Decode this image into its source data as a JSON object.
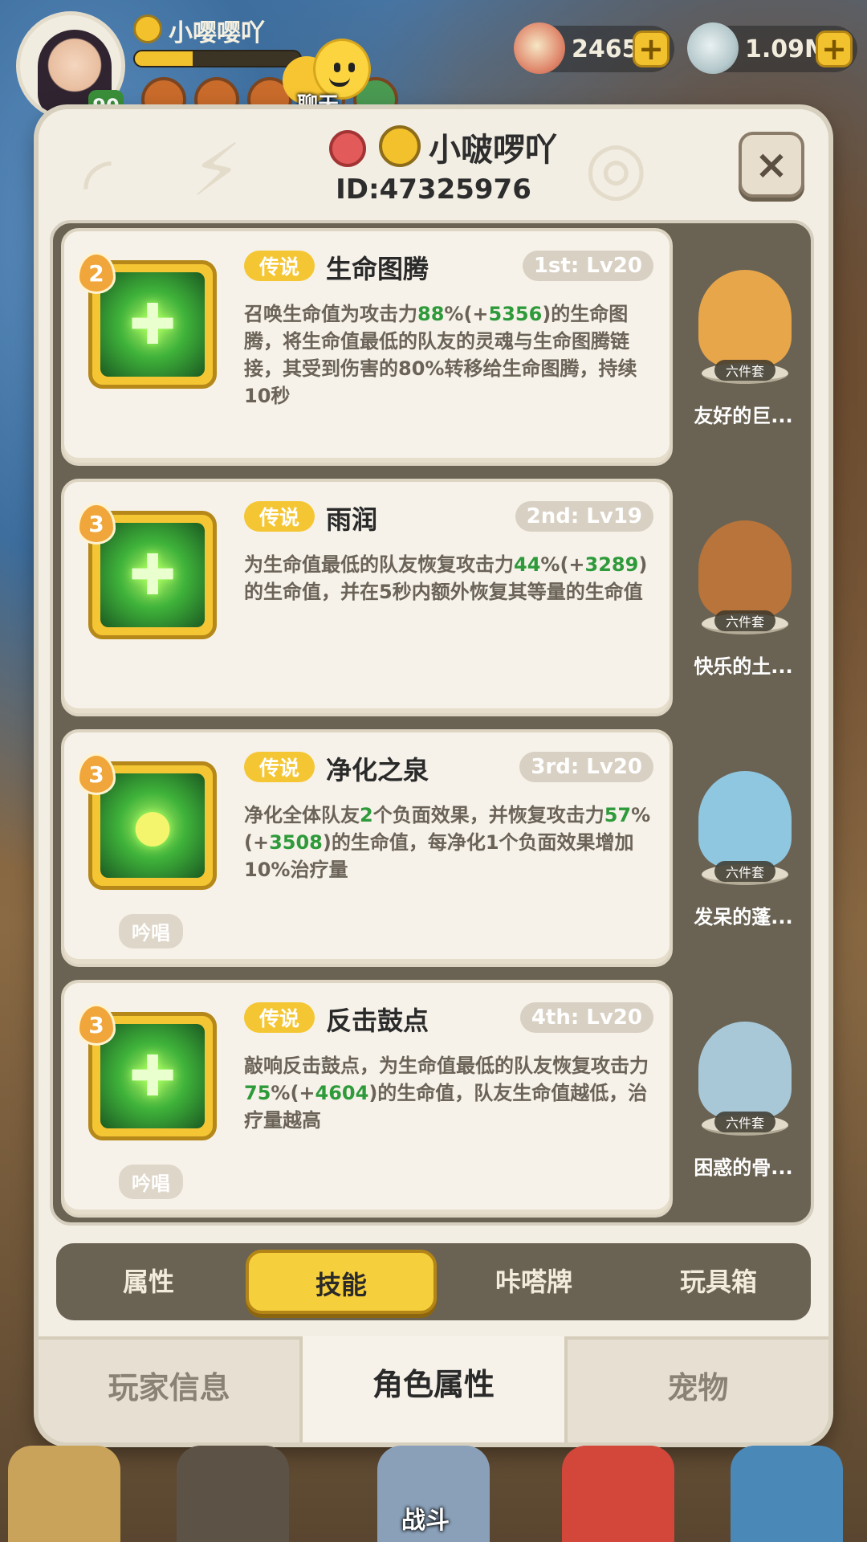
{
  "hud": {
    "player_name": "小嘤嘤吖",
    "level": "90",
    "xp_fraction": 0.35,
    "chat_label": "聊天",
    "currency": [
      {
        "icon": "shell-icon",
        "value": "2465"
      },
      {
        "icon": "clam-icon",
        "value": "1.09M"
      }
    ]
  },
  "modal": {
    "player_name": "小啵啰吖",
    "player_id": "ID:47325976",
    "close_label": "×"
  },
  "skills": [
    {
      "level_badge": "2",
      "rarity": "传说",
      "name": "生命图腾",
      "rank": "1st: Lv20",
      "desc": [
        {
          "t": "召唤生命值为攻击力"
        },
        {
          "t": "88",
          "hl": true
        },
        {
          "t": "%(+"
        },
        {
          "t": "5356",
          "hl": true
        },
        {
          "t": ")的生命图腾，将生命值最低的队友的灵魂与生命图腾链接，其受到伤害的80%转移给生命图腾，持续10秒"
        }
      ],
      "chant": "",
      "set_tag": "六件套",
      "set_name": "友好的巨...",
      "set_color": "#e8a64a"
    },
    {
      "level_badge": "3",
      "rarity": "传说",
      "name": "雨润",
      "rank": "2nd: Lv19",
      "desc": [
        {
          "t": "为生命值最低的队友恢复攻击力"
        },
        {
          "t": "44",
          "hl": true
        },
        {
          "t": "%(+"
        },
        {
          "t": "3289",
          "hl": true
        },
        {
          "t": ")的生命值，并在5秒内额外恢复其等量的生命值"
        }
      ],
      "chant": "",
      "set_tag": "六件套",
      "set_name": "快乐的土...",
      "set_color": "#b8743a"
    },
    {
      "level_badge": "3",
      "rarity": "传说",
      "name": "净化之泉",
      "rank": "3rd: Lv20",
      "desc": [
        {
          "t": "净化全体队友"
        },
        {
          "t": "2",
          "hl": true
        },
        {
          "t": "个负面效果，并恢复攻击力"
        },
        {
          "t": "57",
          "hl": true
        },
        {
          "t": "%(+"
        },
        {
          "t": "3508",
          "hl": true
        },
        {
          "t": ")的生命值，每净化1个负面效果增加10%治疗量"
        }
      ],
      "chant": "吟唱",
      "set_tag": "六件套",
      "set_name": "发呆的蓬...",
      "set_color": "#8fc6e0"
    },
    {
      "level_badge": "3",
      "rarity": "传说",
      "name": "反击鼓点",
      "rank": "4th: Lv20",
      "desc": [
        {
          "t": "敲响反击鼓点，为生命值最低的队友恢复攻击力"
        },
        {
          "t": "75",
          "hl": true
        },
        {
          "t": "%(+"
        },
        {
          "t": "4604",
          "hl": true
        },
        {
          "t": ")的生命值，队友生命值越低，治疗量越高"
        }
      ],
      "chant": "吟唱",
      "set_tag": "六件套",
      "set_name": "困惑的骨...",
      "set_color": "#a8c8d8"
    }
  ],
  "subtabs": [
    "属性",
    "技能",
    "咔嗒牌",
    "玩具箱"
  ],
  "maintabs": [
    "玩家信息",
    "角色属性",
    "宠物"
  ],
  "bottom_nav": {
    "battle_label": "战斗"
  }
}
